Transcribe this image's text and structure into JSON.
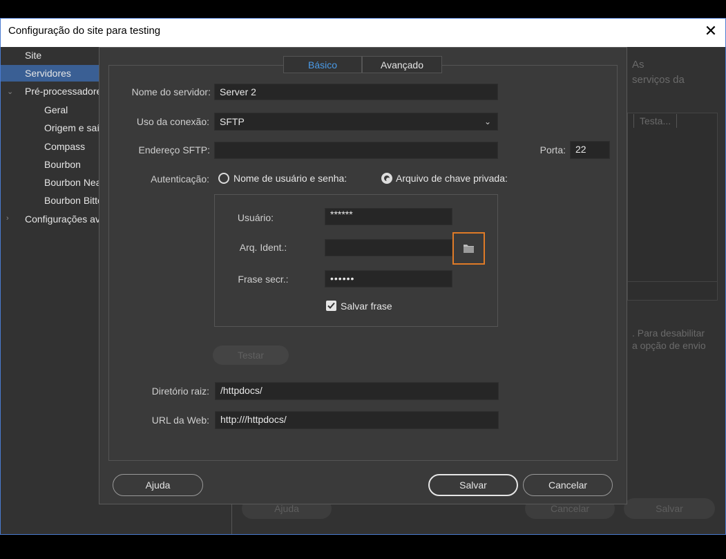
{
  "window": {
    "title": "Configuração do site para testing",
    "close_glyph": "✕"
  },
  "tree": {
    "items": [
      {
        "label": "Site",
        "selected": false
      },
      {
        "label": "Servidores",
        "selected": true
      },
      {
        "label": "Pré-processadores",
        "selected": false,
        "expander": "chevron-down"
      },
      {
        "label": "Geral",
        "selected": false
      },
      {
        "label": "Origem e saída",
        "selected": false
      },
      {
        "label": "Compass",
        "selected": false
      },
      {
        "label": "Bourbon",
        "selected": false
      },
      {
        "label": "Bourbon Neat",
        "selected": false
      },
      {
        "label": "Bourbon Bitters",
        "selected": false
      },
      {
        "label": "Configurações avançadas",
        "selected": false,
        "expander": "chevron-right"
      }
    ]
  },
  "background": {
    "text_1": "As",
    "text_2": "serviços da",
    "column": "Testa...",
    "note_1": ". Para desabilitar",
    "note_2": "a opção de envio",
    "help": "Ajuda",
    "cancel": "Cancelar",
    "save": "Salvar"
  },
  "dialog": {
    "tabs": [
      {
        "label": "Básico",
        "active": true
      },
      {
        "label": "Avançado",
        "active": false
      }
    ],
    "server_name_label": "Nome do servidor:",
    "server_name": "Server 2",
    "connection_label": "Uso da conexão:",
    "connection": "SFTP",
    "address_label": "Endereço SFTP:",
    "address": "",
    "port_label": "Porta:",
    "port": "22",
    "auth_label": "Autenticação:",
    "auth_options": [
      {
        "label": "Nome de usuário e senha:",
        "selected": false
      },
      {
        "label": "Arquivo de chave privada:",
        "selected": true
      }
    ],
    "user_label": "Usuário:",
    "user": "******",
    "identity_label": "Arq. Ident.:",
    "identity": "",
    "passphrase_label": "Frase secr.:",
    "passphrase": "••••••",
    "save_phrase_label": "Salvar frase",
    "save_phrase_checked": true,
    "test_button": "Testar",
    "root_label": "Diretório raiz:",
    "root": "/httpdocs/",
    "url_label": "URL da Web:",
    "url": "http:///httpdocs/",
    "help_button": "Ajuda",
    "save_button": "Salvar",
    "cancel_button": "Cancelar"
  },
  "colors": {
    "accent": "#e07b27",
    "tab_active": "#4a9be8",
    "selection": "#3a5f94"
  },
  "icons": [
    "close-icon",
    "chevron-down-icon",
    "chevron-right-icon",
    "folder-icon",
    "checkbox-checked-icon"
  ]
}
